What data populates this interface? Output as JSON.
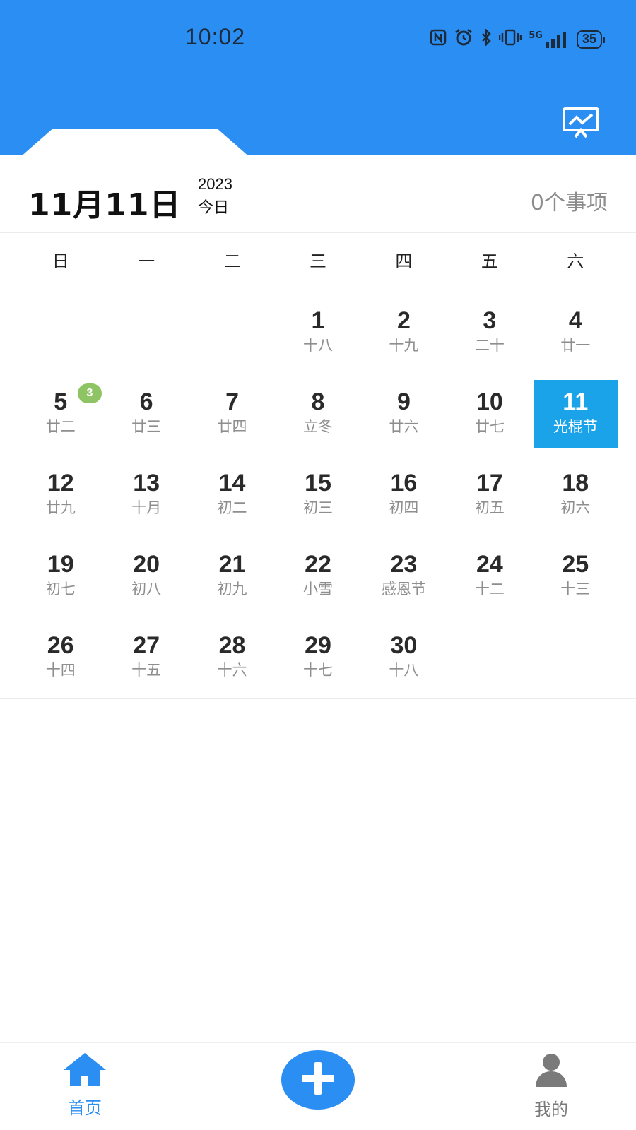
{
  "status_bar": {
    "time": "10:02",
    "icons": [
      "nfc-icon",
      "alarm-icon",
      "bluetooth-icon",
      "vibrate-icon",
      "signal-icon"
    ],
    "network": "5G",
    "battery": "35"
  },
  "header": {
    "background_color": "#2b8ef2",
    "right_icon": "screen-chart-icon"
  },
  "date_bar": {
    "date": "11月11日",
    "year": "2023",
    "today_label": "今日",
    "event_count": "0个事项"
  },
  "calendar": {
    "weekdays": [
      "日",
      "一",
      "二",
      "三",
      "四",
      "五",
      "六"
    ],
    "selected_color": "#1aa3e8",
    "days": [
      {
        "num": "",
        "sub": ""
      },
      {
        "num": "",
        "sub": ""
      },
      {
        "num": "",
        "sub": ""
      },
      {
        "num": "1",
        "sub": "十八"
      },
      {
        "num": "2",
        "sub": "十九"
      },
      {
        "num": "3",
        "sub": "二十"
      },
      {
        "num": "4",
        "sub": "廿一"
      },
      {
        "num": "5",
        "sub": "廿二",
        "badge": "3"
      },
      {
        "num": "6",
        "sub": "廿三"
      },
      {
        "num": "7",
        "sub": "廿四"
      },
      {
        "num": "8",
        "sub": "立冬"
      },
      {
        "num": "9",
        "sub": "廿六"
      },
      {
        "num": "10",
        "sub": "廿七"
      },
      {
        "num": "11",
        "sub": "光棍节",
        "selected": true
      },
      {
        "num": "12",
        "sub": "廿九"
      },
      {
        "num": "13",
        "sub": "十月"
      },
      {
        "num": "14",
        "sub": "初二"
      },
      {
        "num": "15",
        "sub": "初三"
      },
      {
        "num": "16",
        "sub": "初四"
      },
      {
        "num": "17",
        "sub": "初五"
      },
      {
        "num": "18",
        "sub": "初六"
      },
      {
        "num": "19",
        "sub": "初七"
      },
      {
        "num": "20",
        "sub": "初八"
      },
      {
        "num": "21",
        "sub": "初九"
      },
      {
        "num": "22",
        "sub": "小雪"
      },
      {
        "num": "23",
        "sub": "感恩节"
      },
      {
        "num": "24",
        "sub": "十二"
      },
      {
        "num": "25",
        "sub": "十三"
      },
      {
        "num": "26",
        "sub": "十四"
      },
      {
        "num": "27",
        "sub": "十五"
      },
      {
        "num": "28",
        "sub": "十六"
      },
      {
        "num": "29",
        "sub": "十七"
      },
      {
        "num": "30",
        "sub": "十八"
      },
      {
        "num": "",
        "sub": ""
      },
      {
        "num": "",
        "sub": ""
      }
    ]
  },
  "bottom_nav": {
    "home_label": "首页",
    "home_icon": "home-icon",
    "add_icon": "plus-icon",
    "mine_label": "我的",
    "mine_icon": "user-icon",
    "active_color": "#2b8ef2",
    "inactive_color": "#7a7a7a"
  }
}
